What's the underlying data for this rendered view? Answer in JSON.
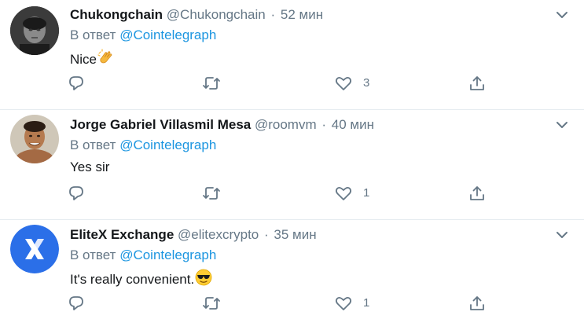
{
  "tweets": [
    {
      "name": "Chukongchain",
      "handle": "@Chukongchain",
      "separator": "·",
      "time": "52 мин",
      "reply_prefix": "В ответ",
      "reply_to": "@Cointelegraph",
      "text": "Nice",
      "emoji": "clapping-hands-icon",
      "likes": "3"
    },
    {
      "name": "Jorge Gabriel Villasmil Mesa",
      "handle": "@roomvm",
      "separator": "·",
      "time": "40 мин",
      "reply_prefix": "В ответ",
      "reply_to": "@Cointelegraph",
      "text": "Yes sir",
      "likes": "1"
    },
    {
      "name": "EliteX Exchange",
      "handle": "@elitexcrypto",
      "separator": "·",
      "time": "35 мин",
      "reply_prefix": "В ответ",
      "reply_to": "@Cointelegraph",
      "text": "It's really convenient.",
      "emoji": "sunglasses-face-icon",
      "likes": "1"
    }
  ],
  "colors": {
    "text": "#14171a",
    "secondary": "#657786",
    "link": "#1b95e0",
    "divider": "#e6ecf0",
    "elitex_brand": "#2b6fe8"
  }
}
